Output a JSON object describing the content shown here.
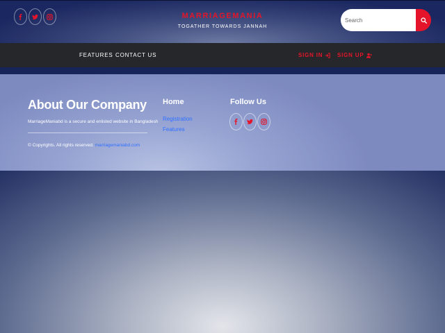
{
  "header": {
    "brand_title": "MARRIAGEMANIA",
    "tagline": "TOGATHER TOWARDS JANNAH",
    "social_icons": [
      "facebook-icon",
      "twitter-icon",
      "instagram-icon"
    ],
    "search": {
      "placeholder": "Search",
      "value": ""
    }
  },
  "nav": {
    "features": "FEATURES",
    "contact": "CONTACT US",
    "sign_in": "SIGN IN",
    "sign_up": "SIGN UP"
  },
  "footer": {
    "about_heading": "About Our Company",
    "about_text": "MarriageManiabd is a secure and enlisted website in Bangladesh",
    "copyright_prefix": "© Copyrights. All rights reserved.",
    "copyright_link": "marriagemaniabd.com",
    "home_heading": "Home",
    "links": [
      "Registration",
      "Features"
    ],
    "follow_heading": "Follow Us"
  },
  "colors": {
    "accent": "#e4152a",
    "link": "#2f6fff",
    "navbar": "#25272a"
  }
}
